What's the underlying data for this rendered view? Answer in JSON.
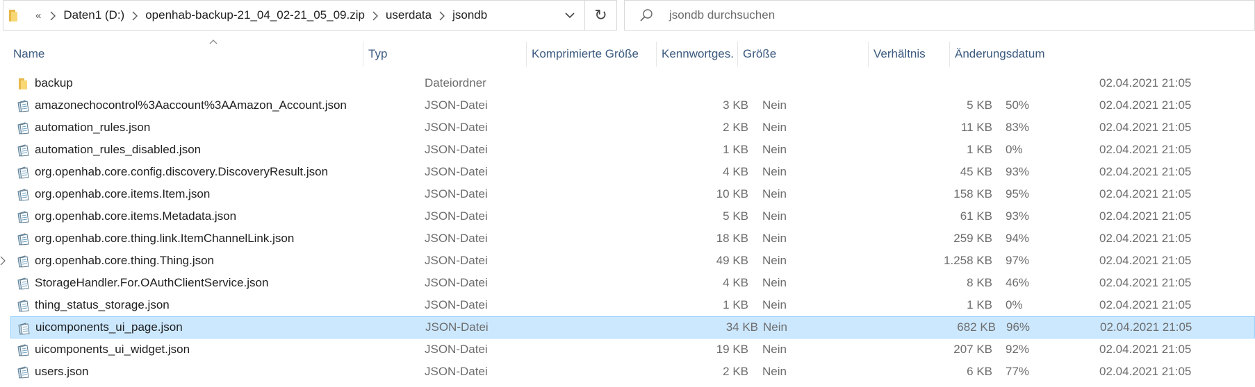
{
  "breadcrumb": {
    "overflow": "«",
    "items": [
      "Daten1 (D:)",
      "openhab-backup-21_04_02-21_05_09.zip",
      "userdata",
      "jsondb"
    ]
  },
  "search": {
    "placeholder": "jsondb durchsuchen"
  },
  "columns": {
    "name": "Name",
    "type": "Typ",
    "compressed": "Komprimierte Größe",
    "password": "Kennwortges...",
    "size": "Größe",
    "ratio": "Verhältnis",
    "date": "Änderungsdatum"
  },
  "files": [
    {
      "icon": "folder-icon",
      "name": "backup",
      "type": "Dateiordner",
      "compressed": "",
      "password": "",
      "size": "",
      "ratio": "",
      "date": "02.04.2021 21:05",
      "selected": false
    },
    {
      "icon": "json-file-icon",
      "name": "amazonechocontrol%3Aaccount%3AAmazon_Account.json",
      "type": "JSON-Datei",
      "compressed": "3 KB",
      "password": "Nein",
      "size": "5 KB",
      "ratio": "50%",
      "date": "02.04.2021 21:05",
      "selected": false
    },
    {
      "icon": "json-file-icon",
      "name": "automation_rules.json",
      "type": "JSON-Datei",
      "compressed": "2 KB",
      "password": "Nein",
      "size": "11 KB",
      "ratio": "83%",
      "date": "02.04.2021 21:05",
      "selected": false
    },
    {
      "icon": "json-file-icon",
      "name": "automation_rules_disabled.json",
      "type": "JSON-Datei",
      "compressed": "1 KB",
      "password": "Nein",
      "size": "1 KB",
      "ratio": "0%",
      "date": "02.04.2021 21:05",
      "selected": false
    },
    {
      "icon": "json-file-icon",
      "name": "org.openhab.core.config.discovery.DiscoveryResult.json",
      "type": "JSON-Datei",
      "compressed": "4 KB",
      "password": "Nein",
      "size": "45 KB",
      "ratio": "93%",
      "date": "02.04.2021 21:05",
      "selected": false
    },
    {
      "icon": "json-file-icon",
      "name": "org.openhab.core.items.Item.json",
      "type": "JSON-Datei",
      "compressed": "10 KB",
      "password": "Nein",
      "size": "158 KB",
      "ratio": "95%",
      "date": "02.04.2021 21:05",
      "selected": false
    },
    {
      "icon": "json-file-icon",
      "name": "org.openhab.core.items.Metadata.json",
      "type": "JSON-Datei",
      "compressed": "5 KB",
      "password": "Nein",
      "size": "61 KB",
      "ratio": "93%",
      "date": "02.04.2021 21:05",
      "selected": false
    },
    {
      "icon": "json-file-icon",
      "name": "org.openhab.core.thing.link.ItemChannelLink.json",
      "type": "JSON-Datei",
      "compressed": "18 KB",
      "password": "Nein",
      "size": "259 KB",
      "ratio": "94%",
      "date": "02.04.2021 21:05",
      "selected": false
    },
    {
      "icon": "json-file-icon",
      "name": "org.openhab.core.thing.Thing.json",
      "type": "JSON-Datei",
      "compressed": "49 KB",
      "password": "Nein",
      "size": "1.258 KB",
      "ratio": "97%",
      "date": "02.04.2021 21:05",
      "selected": false
    },
    {
      "icon": "json-file-icon",
      "name": "StorageHandler.For.OAuthClientService.json",
      "type": "JSON-Datei",
      "compressed": "4 KB",
      "password": "Nein",
      "size": "8 KB",
      "ratio": "46%",
      "date": "02.04.2021 21:05",
      "selected": false
    },
    {
      "icon": "json-file-icon",
      "name": "thing_status_storage.json",
      "type": "JSON-Datei",
      "compressed": "1 KB",
      "password": "Nein",
      "size": "1 KB",
      "ratio": "0%",
      "date": "02.04.2021 21:05",
      "selected": false
    },
    {
      "icon": "json-file-icon",
      "name": "uicomponents_ui_page.json",
      "type": "JSON-Datei",
      "compressed": "34 KB",
      "password": "Nein",
      "size": "682 KB",
      "ratio": "96%",
      "date": "02.04.2021 21:05",
      "selected": true
    },
    {
      "icon": "json-file-icon",
      "name": "uicomponents_ui_widget.json",
      "type": "JSON-Datei",
      "compressed": "19 KB",
      "password": "Nein",
      "size": "207 KB",
      "ratio": "92%",
      "date": "02.04.2021 21:05",
      "selected": false
    },
    {
      "icon": "json-file-icon",
      "name": "users.json",
      "type": "JSON-Datei",
      "compressed": "2 KB",
      "password": "Nein",
      "size": "6 KB",
      "ratio": "77%",
      "date": "02.04.2021 21:05",
      "selected": false
    }
  ],
  "colors": {
    "header_text": "#3c5a7f",
    "selection_bg": "#cce8ff",
    "selection_border": "#99d1ff",
    "folder": "#f8d775"
  }
}
